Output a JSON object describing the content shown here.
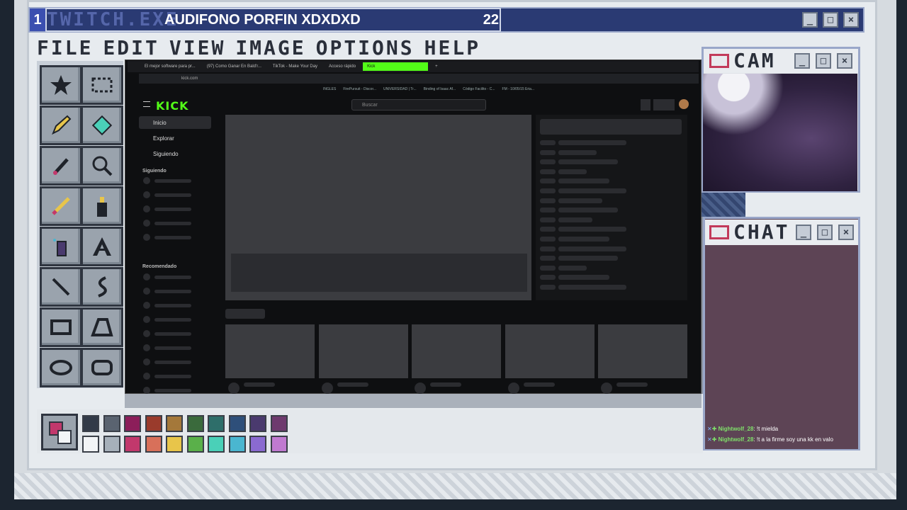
{
  "title": {
    "number": "1",
    "ghost": "TWITCH.EXE",
    "text": "AUDIFONO PORFIN XDXDXD",
    "count": "22"
  },
  "window_buttons": {
    "min": "_",
    "max": "□",
    "close": "×"
  },
  "menu": [
    "FILE",
    "EDIT",
    "VIEW",
    "IMAGE",
    "OPTIONS",
    "HELP"
  ],
  "tools": [
    "star-stamp",
    "rect-select",
    "pencil",
    "fill-bucket",
    "color-picker",
    "magnifier",
    "brush",
    "spray-can",
    "paint-tube",
    "text-tool",
    "line-tool",
    "curve-tool",
    "rectangle-tool",
    "polygon-tool",
    "ellipse-tool",
    "rounded-rect-tool"
  ],
  "palette": {
    "row1": [
      "#323a48",
      "#5a6370",
      "#8c1e5a",
      "#9a3b2c",
      "#a4783a",
      "#3a6a3c",
      "#2e6e6a",
      "#2e4f7a",
      "#4a3a6e",
      "#6e3a6e"
    ],
    "row2": [
      "#f2f4f6",
      "#a6b0ba",
      "#c2386c",
      "#d8705a",
      "#e8c54a",
      "#5ab04a",
      "#4ad0b8",
      "#4ab6d0",
      "#8a6ad0",
      "#c07ad0"
    ],
    "current_fg": "#c2386c",
    "current_bg": "#f2f4f6"
  },
  "browser": {
    "tabs": [
      "El mejor software para pr...",
      "(97) Como Ganar En Bald'r...",
      "TikTok - Make Your Day",
      "Acceso rápido",
      "Kick"
    ],
    "new_tab": "+",
    "url": "kick.com",
    "bookmarks": [
      "INGLES",
      "FirePursuit - Discor...",
      "UNIVERSIDAD | Tr...",
      "Binding of Isaac Af...",
      "Código Facilito - C...",
      "FM - 10/05/15 Eria..."
    ],
    "site_logo": "KICK",
    "search_placeholder": "Buscar",
    "nav": {
      "inicio": "Inicio",
      "explorar": "Explorar",
      "siguiendo": "Siguiendo"
    },
    "sections": {
      "following": "Siguiendo",
      "recommended": "Recomendado"
    }
  },
  "cam": {
    "label": "CAM"
  },
  "chat": {
    "label": "CHAT",
    "messages": [
      {
        "user": "Nightwolf_28",
        "text": "!t mielda"
      },
      {
        "user": "Nightwolf_28",
        "text": "!t a la firme soy una kk en valo"
      }
    ]
  }
}
